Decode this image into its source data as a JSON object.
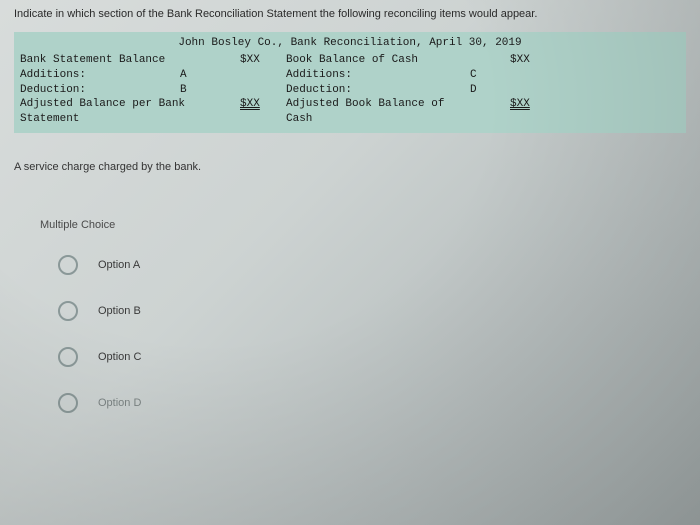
{
  "question": "Indicate in which section of the Bank Reconciliation Statement the following reconciling items would appear.",
  "reconciliation": {
    "title": "John Bosley Co., Bank Reconciliation, April 30, 2019",
    "left": {
      "balance_label": "Bank Statement Balance",
      "balance_amt": "$XX",
      "additions_label": "Additions:",
      "additions_letter": "A",
      "deduction_label": "Deduction:",
      "deduction_letter": "B",
      "adjusted_label": "Adjusted Balance per Bank Statement",
      "adjusted_amt": "$XX"
    },
    "right": {
      "balance_label": "Book Balance of Cash",
      "balance_amt": "$XX",
      "additions_label": "Additions:",
      "additions_letter": "C",
      "deduction_label": "Deduction:",
      "deduction_letter": "D",
      "adjusted_label": "Adjusted Book Balance of Cash",
      "adjusted_amt": "$XX"
    }
  },
  "sub_question": "A service charge charged by the bank.",
  "mc": {
    "title": "Multiple Choice",
    "options": [
      "Option A",
      "Option B",
      "Option C",
      "Option D"
    ]
  }
}
